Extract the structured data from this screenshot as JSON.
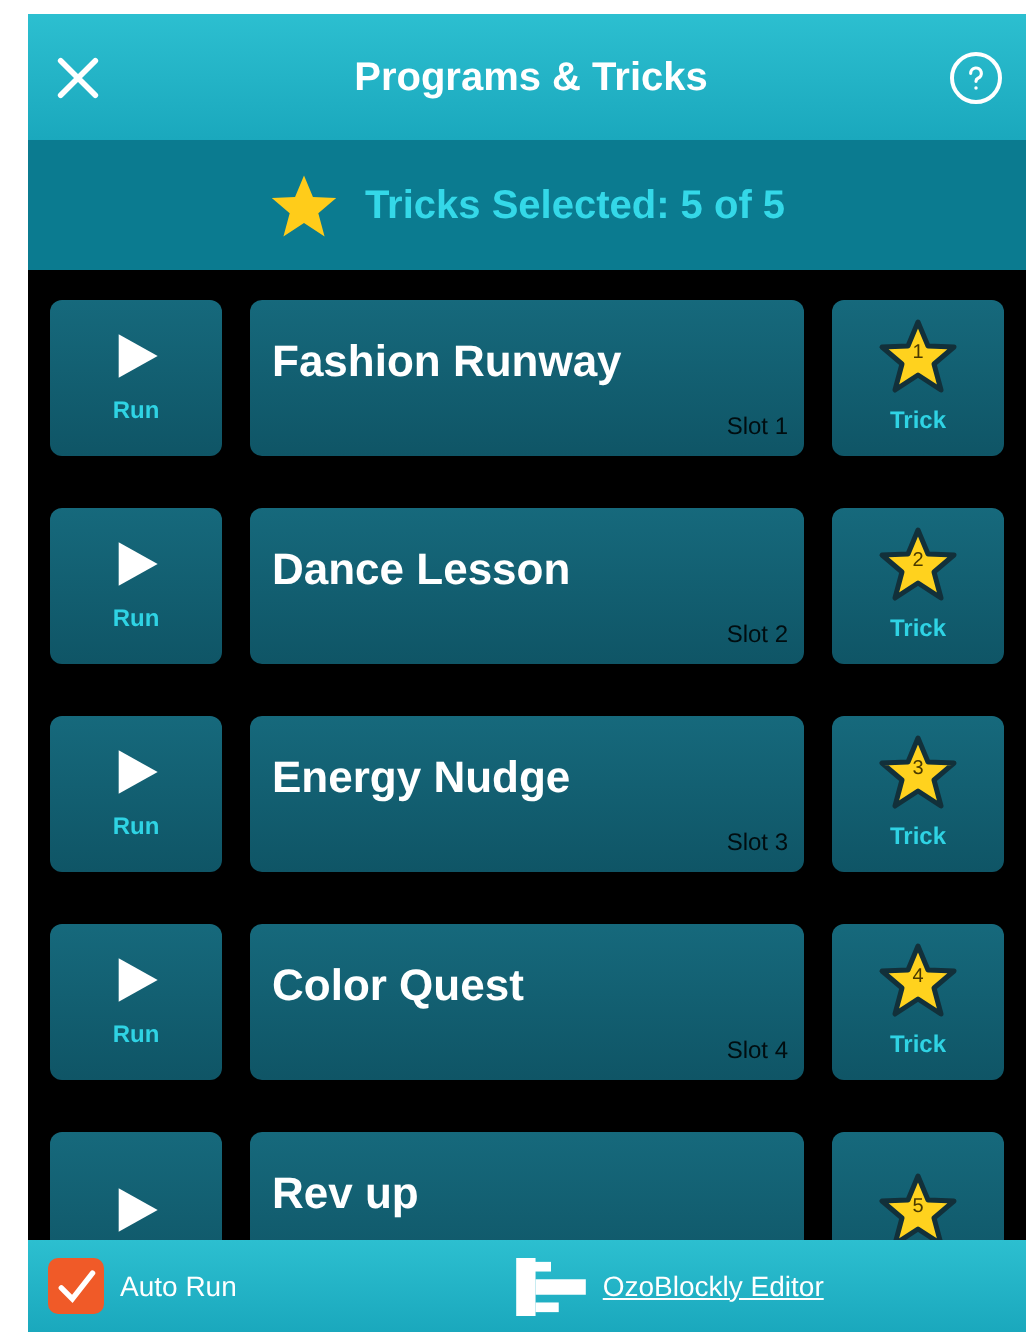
{
  "header": {
    "title": "Programs & Tricks"
  },
  "summary": {
    "text": "Tricks Selected: 5 of 5"
  },
  "programs": [
    {
      "name": "Fashion Runway",
      "slot": "Slot 1",
      "run_label": "Run",
      "trick_label": "Trick",
      "number": "1",
      "trick": true
    },
    {
      "name": "Dance Lesson",
      "slot": "Slot 2",
      "run_label": "Run",
      "trick_label": "Trick",
      "number": "2",
      "trick": true
    },
    {
      "name": "Energy Nudge",
      "slot": "Slot 3",
      "run_label": "Run",
      "trick_label": "Trick",
      "number": "3",
      "trick": true
    },
    {
      "name": "Color Quest",
      "slot": "Slot 4",
      "run_label": "Run",
      "trick_label": "Trick",
      "number": "4",
      "trick": true
    },
    {
      "name": "Rev up",
      "number": "5",
      "trick": true
    }
  ],
  "footer": {
    "auto_run": {
      "label": "Auto Run",
      "checked": true
    },
    "editor_link": "OzoBlockly Editor"
  }
}
